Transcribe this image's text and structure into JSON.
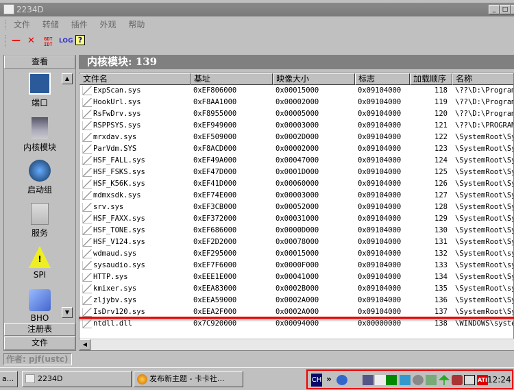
{
  "window": {
    "title": "2234D"
  },
  "menu": [
    "文件",
    "转储",
    "插件",
    "外观",
    "帮助"
  ],
  "toolbar": {
    "minus": "—",
    "close": "✕",
    "gdt": "GDT",
    "idt": "IDT",
    "log": "LOG",
    "help": "?"
  },
  "left_panel": {
    "top_button": "查看",
    "items": [
      "端口",
      "内核模块",
      "启动组",
      "服务",
      "SPI",
      "BHO"
    ],
    "bottom_buttons": [
      "注册表",
      "文件"
    ]
  },
  "header": {
    "title": "内核模块: 139"
  },
  "table": {
    "columns": [
      "文件名",
      "基址",
      "映像大小",
      "标志",
      "加载顺序",
      "名称"
    ],
    "rows": [
      [
        "ExpScan.sys",
        "0xEF806000",
        "0x00015000",
        "0x09104000",
        "118",
        "\\??\\D:\\Program"
      ],
      [
        "HookUrl.sys",
        "0xF8AA1000",
        "0x00002000",
        "0x09104000",
        "119",
        "\\??\\D:\\Program"
      ],
      [
        "RsFwDrv.sys",
        "0xF8955000",
        "0x00005000",
        "0x09104000",
        "120",
        "\\??\\D:\\Program"
      ],
      [
        "RSPPSYS.sys",
        "0xEF949000",
        "0x00003000",
        "0x09104000",
        "121",
        "\\??\\D:\\PROGRAM"
      ],
      [
        "mrxdav.sys",
        "0xEF509000",
        "0x0002D000",
        "0x09104000",
        "122",
        "\\SystemRoot\\Sy"
      ],
      [
        "ParVdm.SYS",
        "0xF8ACD000",
        "0x00002000",
        "0x09104000",
        "123",
        "\\SystemRoot\\Sy"
      ],
      [
        "HSF_FALL.sys",
        "0xEF49A000",
        "0x00047000",
        "0x09104000",
        "124",
        "\\SystemRoot\\Sy"
      ],
      [
        "HSF_FSKS.sys",
        "0xEF47D000",
        "0x0001D000",
        "0x09104000",
        "125",
        "\\SystemRoot\\Sy"
      ],
      [
        "HSF_K56K.sys",
        "0xEF41D000",
        "0x00060000",
        "0x09104000",
        "126",
        "\\SystemRoot\\Sy"
      ],
      [
        "mdmxsdk.sys",
        "0xEF74E000",
        "0x00003000",
        "0x09104000",
        "127",
        "\\SystemRoot\\Sy"
      ],
      [
        "srv.sys",
        "0xEF3CB000",
        "0x00052000",
        "0x09104000",
        "128",
        "\\SystemRoot\\Sy"
      ],
      [
        "HSF_FAXX.sys",
        "0xEF372000",
        "0x00031000",
        "0x09104000",
        "129",
        "\\SystemRoot\\Sy"
      ],
      [
        "HSF_TONE.sys",
        "0xEF686000",
        "0x0000D000",
        "0x09104000",
        "130",
        "\\SystemRoot\\Sy"
      ],
      [
        "HSF_V124.sys",
        "0xEF2D2000",
        "0x00078000",
        "0x09104000",
        "131",
        "\\SystemRoot\\Sy"
      ],
      [
        "wdmaud.sys",
        "0xEF295000",
        "0x00015000",
        "0x09104000",
        "132",
        "\\SystemRoot\\sy"
      ],
      [
        "sysaudio.sys",
        "0xEF7F6000",
        "0x0000F000",
        "0x09104000",
        "133",
        "\\SystemRoot\\sy"
      ],
      [
        "HTTP.sys",
        "0xEEE1E000",
        "0x00041000",
        "0x09104000",
        "134",
        "\\SystemRoot\\Sy"
      ],
      [
        "kmixer.sys",
        "0xEEA83000",
        "0x0002B000",
        "0x09104000",
        "135",
        "\\SystemRoot\\sy"
      ],
      [
        "zljybv.sys",
        "0xEEA59000",
        "0x0002A000",
        "0x09104000",
        "136",
        "\\SystemRoot\\Sy"
      ],
      [
        "IsDrv120.sys",
        "0xEEA2F000",
        "0x0002A000",
        "0x09104000",
        "137",
        "\\SystemRoot\\Sy"
      ],
      [
        "ntdll.dll",
        "0x7C920000",
        "0x00094000",
        "0x00000000",
        "138",
        "\\WINDOWS\\syste"
      ]
    ]
  },
  "status": {
    "author": "作者: pjf(ustc)"
  },
  "taskbar": {
    "tasks": [
      "a...",
      "2234D",
      "发布新主题 - 卡卡社..."
    ],
    "tray": {
      "ime": "CH",
      "expand": "»",
      "clock": "12:24"
    }
  },
  "colors": {
    "highlight_line": "#e00000",
    "header_bg": "#808080"
  }
}
